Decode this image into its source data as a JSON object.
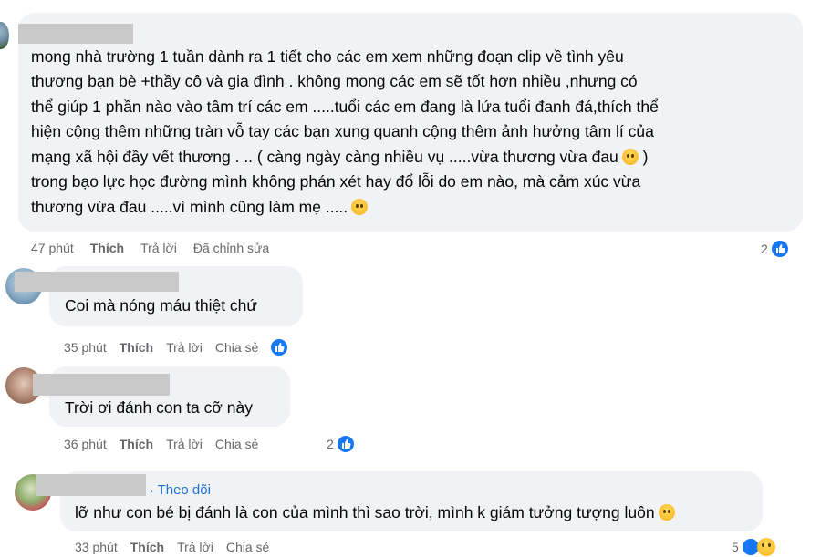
{
  "comments": [
    {
      "lines": [
        "mong nhà trường 1 tuần dành ra 1 tiết cho các em xem những đoạn clip về tình yêu",
        "thương bạn bè +thầy cô và gia đình . không mong các em sẽ tốt hơn nhiều ,nhưng có",
        "thể giúp 1 phần nào vào tâm trí các em .....tuổi các em đang là lứa tuổi đanh đá,thích thể",
        "hiện cộng thêm những tràn vỗ tay các bạn xung quanh cộng thêm ảnh hưởng tâm lí của",
        "mạng xã hội đầy vết thương . .. ( càng ngày càng nhiều vụ .....vừa thương vừa đau",
        ")",
        "trong bạo lực học đường mình không phán xét hay đổ lỗi do em nào, mà cảm xúc vừa",
        "thương vừa đau .....vì mình cũng làm mẹ ....."
      ],
      "time": "47 phút",
      "like": "Thích",
      "reply": "Trả lời",
      "edited": "Đã chỉnh sửa",
      "reactions": "2"
    },
    {
      "text": "Coi mà nóng máu thiệt chứ",
      "time": "35 phút",
      "like": "Thích",
      "reply": "Trả lời",
      "share": "Chia sẻ"
    },
    {
      "text": "Trời ơi đánh con ta cỡ này",
      "time": "36 phút",
      "like": "Thích",
      "reply": "Trả lời",
      "share": "Chia sẻ",
      "reactions": "2"
    },
    {
      "follow": "Theo dõi",
      "text": "lỡ như con bé bị đánh là con của mình thì sao trời, mình k giám tưởng tượng luôn",
      "time": "33 phút",
      "like": "Thích",
      "reply": "Trả lời",
      "share": "Chia sẻ",
      "reactions": "5"
    }
  ],
  "colors": {
    "bubble": "#f0f2f5",
    "meta_text": "#65676b",
    "like_blue": "#1877f2",
    "follow_blue": "#216fdb"
  },
  "icons": [
    "like-icon",
    "sad-emoji-icon",
    "pleading-emoji-icon",
    "haha-emoji-icon"
  ]
}
